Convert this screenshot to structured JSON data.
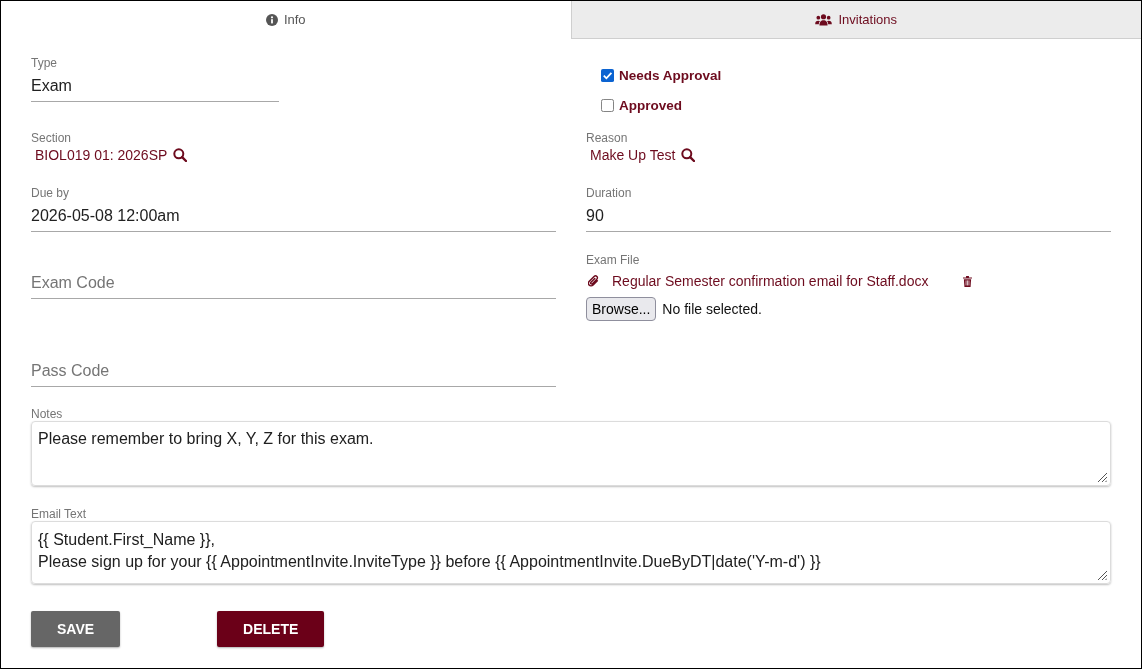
{
  "tabs": [
    {
      "label": "Info",
      "selected": true
    },
    {
      "label": "Invitations",
      "selected": false
    }
  ],
  "type": {
    "label": "Type",
    "value": "Exam"
  },
  "approval": [
    {
      "label": "Needs Approval",
      "checked": true
    },
    {
      "label": "Approved",
      "checked": false
    }
  ],
  "section": {
    "label": "Section",
    "value": "BIOL019 01: 2026SP"
  },
  "reason": {
    "label": "Reason",
    "value": "Make Up Test"
  },
  "due_by": {
    "label": "Due by",
    "value": "2026-05-08 12:00am"
  },
  "duration": {
    "label": "Duration",
    "value": "90"
  },
  "exam_code": {
    "placeholder": "Exam Code"
  },
  "exam_file": {
    "label": "Exam File",
    "file_name": "Regular Semester confirmation email for Staff.docx",
    "browse_button": "Browse...",
    "file_status": "No file selected."
  },
  "pass_code": {
    "placeholder": "Pass Code"
  },
  "notes": {
    "label": "Notes",
    "value": "Please remember to bring X, Y, Z for this exam."
  },
  "email_text": {
    "label": "Email Text",
    "value": "{{ Student.First_Name }},\nPlease sign up for your {{ AppointmentInvite.InviteType }} before {{ AppointmentInvite.DueByDT|date('Y-m-d') }}"
  },
  "buttons": [
    {
      "label": "SAVE",
      "kind": "secondary"
    },
    {
      "label": "DELETE",
      "kind": "danger"
    }
  ]
}
